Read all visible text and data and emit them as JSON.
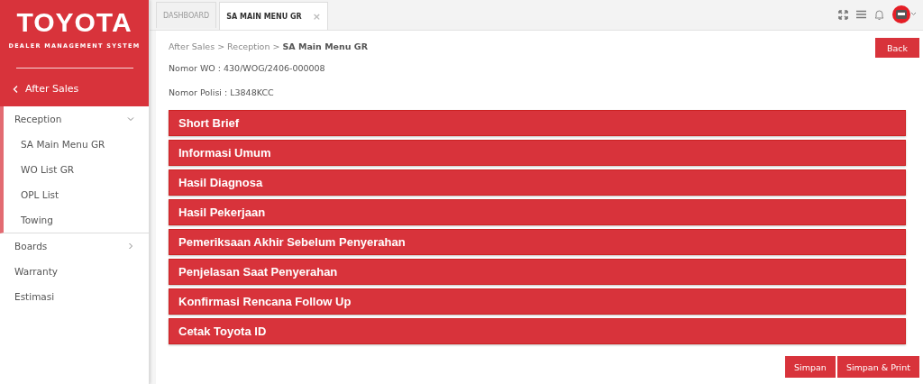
{
  "brand": {
    "logo": "TOYOTA",
    "subtitle": "DEALER MANAGEMENT SYSTEM"
  },
  "sidebar": {
    "back": "After Sales",
    "items": [
      {
        "label": "Reception",
        "kind": "group",
        "expanded": true,
        "children": [
          {
            "label": "SA Main Menu GR"
          },
          {
            "label": "WO List GR"
          },
          {
            "label": "OPL List"
          },
          {
            "label": "Towing"
          }
        ]
      },
      {
        "label": "Boards",
        "kind": "group",
        "expanded": false
      },
      {
        "label": "Warranty",
        "kind": "link"
      },
      {
        "label": "Estimasi",
        "kind": "link"
      }
    ]
  },
  "tabs": [
    {
      "label": "DASHBOARD",
      "selected": false
    },
    {
      "label": "SA MAIN MENU GR",
      "selected": true,
      "close": "×"
    }
  ],
  "breadcrumb": "After Sales > Reception > **SA Main Menu GR**",
  "back_button": "Back",
  "info": [
    "Nomor WO : 430/WOG/2406-000008",
    "Nomor Polisi : L3848KCC"
  ],
  "sections": [
    "Short Brief",
    "Informasi Umum",
    "Hasil Diagnosa",
    "Hasil Pekerjaan",
    "Pemeriksaan Akhir Sebelum Penyerahan",
    "Penjelasan Saat Penyerahan",
    "Konfirmasi Rencana Follow Up",
    "Cetak Toyota ID"
  ],
  "actions": [
    "Simpan",
    "Simpan & Print"
  ]
}
